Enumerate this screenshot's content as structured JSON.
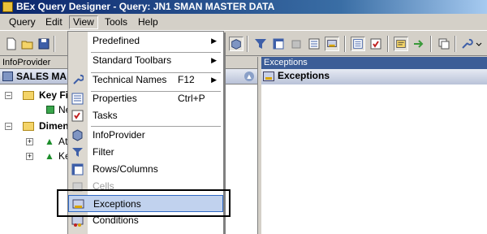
{
  "window": {
    "title": "BEx Query Designer - Query: JN1 SMAN MASTER DATA"
  },
  "menubar": {
    "items": [
      "Query",
      "Edit",
      "View",
      "Tools",
      "Help"
    ]
  },
  "left_panel": {
    "header": "InfoProvider",
    "provider_title": "SALES MA",
    "tree": [
      {
        "label": "Key Fi",
        "bold": true
      },
      {
        "label": "Ne"
      },
      {
        "label": "Dimen",
        "bold": true
      },
      {
        "label": "At"
      },
      {
        "label": "Ke"
      }
    ]
  },
  "right_panel": {
    "header": "Exceptions",
    "title": "Exceptions"
  },
  "view_menu": {
    "items": [
      {
        "label": "Predefined",
        "submenu": true
      },
      {
        "label": "Standard Toolbars",
        "submenu": true
      },
      {
        "label": "Technical Names",
        "shortcut": "F12",
        "submenu": true,
        "icon": "wrench-icon"
      },
      {
        "label": "Properties",
        "shortcut": "Ctrl+P",
        "icon": "properties-icon"
      },
      {
        "label": "Tasks",
        "icon": "tasks-icon"
      },
      {
        "label": "InfoProvider",
        "icon": "cube-icon"
      },
      {
        "label": "Filter",
        "icon": "filter-icon"
      },
      {
        "label": "Rows/Columns",
        "icon": "rows-columns-icon"
      },
      {
        "label": "Cells",
        "disabled": true,
        "icon": "cells-icon"
      },
      {
        "label": "Exceptions",
        "highlighted": true,
        "icon": "exceptions-icon"
      },
      {
        "label": "Conditions",
        "icon": "conditions-icon"
      }
    ]
  },
  "colors": {
    "menu_highlight": "#c1d2ee",
    "panel_header_active": "#3c5d97"
  }
}
